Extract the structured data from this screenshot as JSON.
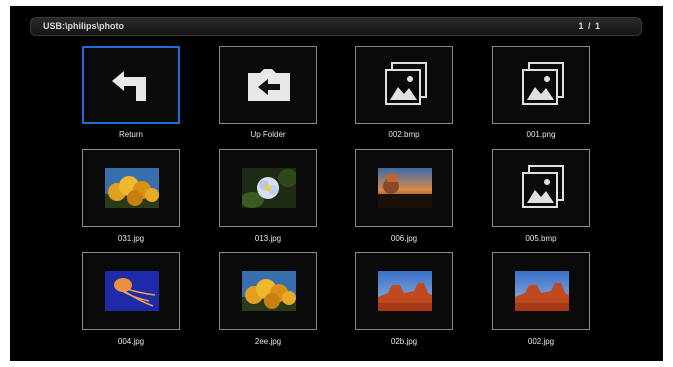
{
  "header": {
    "path": "USB:\\philips\\photo",
    "page_indicator": "1 / 1"
  },
  "items": [
    {
      "label": "Return",
      "kind": "return-icon",
      "selected": true
    },
    {
      "label": "Up Folder",
      "kind": "up-folder-icon"
    },
    {
      "label": "002.bmp",
      "kind": "image-file-icon"
    },
    {
      "label": "001.png",
      "kind": "image-file-icon"
    },
    {
      "label": "031.jpg",
      "kind": "photo-thumbnail",
      "scene": "yellow flowers"
    },
    {
      "label": "013.jpg",
      "kind": "photo-thumbnail",
      "scene": "white flower"
    },
    {
      "label": "006.jpg",
      "kind": "photo-thumbnail",
      "scene": "dusk landscape"
    },
    {
      "label": "005.bmp",
      "kind": "image-file-icon"
    },
    {
      "label": "004.jpg",
      "kind": "photo-thumbnail",
      "scene": "jellyfish"
    },
    {
      "label": "2ee.jpg",
      "kind": "photo-thumbnail",
      "scene": "yellow flowers"
    },
    {
      "label": "02b.jpg",
      "kind": "photo-thumbnail",
      "scene": "red rocks"
    },
    {
      "label": "002.jpg",
      "kind": "photo-thumbnail",
      "scene": "red rocks"
    }
  ],
  "colors": {
    "background": "#000000",
    "tile_border": "#8a8a8a",
    "selected_border": "#1f6fd6",
    "label_text": "#e6e6e6"
  }
}
